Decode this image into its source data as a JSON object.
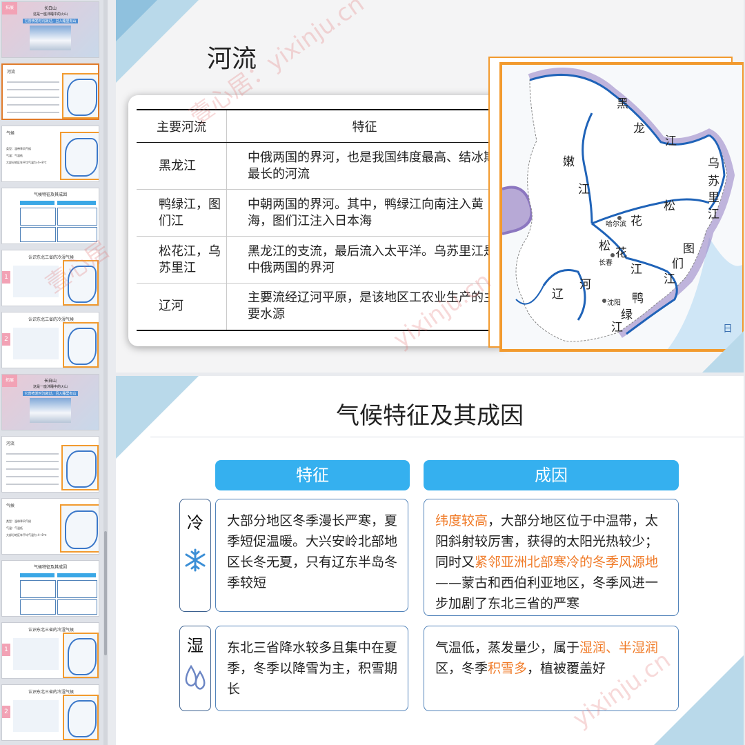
{
  "thumbnails": [
    {
      "kind": "title",
      "badge": "拓展",
      "title": "长白山",
      "subtitle": "这是一座沐睡中的火山",
      "note": "它曾喷发时沉寂过，且入睡里有山"
    },
    {
      "kind": "river",
      "title": "河流"
    },
    {
      "kind": "climate",
      "title": "气候",
      "lines": [
        "类型：温带季风气候",
        "气温：气温低",
        "大部分地区年平均气温为-4~8℃"
      ]
    },
    {
      "kind": "feature",
      "title": "气候特征及其成因"
    },
    {
      "kind": "cold",
      "badge": "1",
      "title": "认识东北三省的冷湿气候"
    },
    {
      "kind": "cold",
      "badge": "2",
      "title": "认识东北三省的冷湿气候"
    },
    {
      "kind": "title",
      "badge": "拓展",
      "title": "长白山",
      "subtitle": "这是一座沐睡中的火山",
      "note": "它曾喷发时沉寂过，且入睡里有山"
    },
    {
      "kind": "river",
      "title": "河流"
    },
    {
      "kind": "climate",
      "title": "气候",
      "lines": [
        "类型：温带季风气候",
        "气温：气温低",
        "大部分地区年平均气温为-4~8℃"
      ]
    },
    {
      "kind": "feature",
      "title": "气候特征及其成因"
    },
    {
      "kind": "cold",
      "badge": "1",
      "title": "认识东北三省的冷湿气候"
    },
    {
      "kind": "cold",
      "badge": "2",
      "title": "认识东北三省的冷湿气候"
    }
  ],
  "slide1": {
    "title": "河流",
    "table": {
      "headers": [
        "主要河流",
        "特征"
      ],
      "rows": [
        {
          "name": "黑龙江",
          "feature": "中俄两国的界河，也是我国纬度最高、结冰期最长的河流"
        },
        {
          "name": "鸭绿江，图们江",
          "feature": "中朝两国的界河。其中，鸭绿江向南注入黄海，图们江注入日本海"
        },
        {
          "name": "松花江，乌苏里江",
          "feature": "黑龙江的支流，最后流入太平洋。乌苏里江是中俄两国的界河"
        },
        {
          "name": "辽河",
          "feature": "主要流经辽河平原，是该地区工农业生产的主要水源"
        }
      ]
    },
    "map_labels": {
      "heilongjiang": [
        "黑",
        "龙",
        "江"
      ],
      "nenjiang": [
        "嫩",
        "江"
      ],
      "wusulijiang": [
        "乌",
        "苏",
        "里",
        "江"
      ],
      "songhua_upper": [
        "松",
        "花"
      ],
      "songhua_lower": [
        "松",
        "花",
        "江"
      ],
      "tumen": [
        "图",
        "们",
        "江"
      ],
      "liao": [
        "辽",
        "河"
      ],
      "yalu": [
        "鸭",
        "绿",
        "江"
      ],
      "harbin": "哈尔滨",
      "changchun": "长春",
      "shenyang": "沈阳",
      "sea": "日"
    }
  },
  "slide2": {
    "title": "气候特征及其成因",
    "col_feature": "特征",
    "col_cause": "成因",
    "rows": [
      {
        "label": "冷",
        "icon": "snowflake-icon",
        "feature": "大部分地区冬季漫长严寒，夏季短促温暖。大兴安岭北部地区长冬无夏，只有辽东半岛冬季较短",
        "cause_parts": [
          {
            "text": "纬度较高",
            "hl": true
          },
          {
            "text": "，大部分地区位于中温带，太阳斜射较厉害，获得的太阳光热较少；同时又",
            "hl": false
          },
          {
            "text": "紧邻亚洲北部寒冷的冬季风源地",
            "hl": true
          },
          {
            "text": "——蒙古和西伯利亚地区，冬季风进一步加剧了东北三省的严寒",
            "hl": false
          }
        ]
      },
      {
        "label": "湿",
        "icon": "water-drops-icon",
        "feature": "东北三省降水较多且集中在夏季，冬季以降雪为主，积雪期长",
        "cause_parts": [
          {
            "text": "气温低，蒸发量少，属于",
            "hl": false
          },
          {
            "text": "湿润、半湿润",
            "hl": true
          },
          {
            "text": "区，冬季",
            "hl": false
          },
          {
            "text": "积雪多",
            "hl": true
          },
          {
            "text": "，植被覆盖好",
            "hl": false
          }
        ]
      }
    ]
  },
  "watermarks": [
    "壹心居：yixinju.cn",
    "yixinju.cn",
    "壹心居",
    "yixinju.cn"
  ],
  "colors": {
    "accent": "#35b0ef",
    "highlight": "#f07b28",
    "frame": "#f29a2e",
    "river": "#1f63b8"
  }
}
